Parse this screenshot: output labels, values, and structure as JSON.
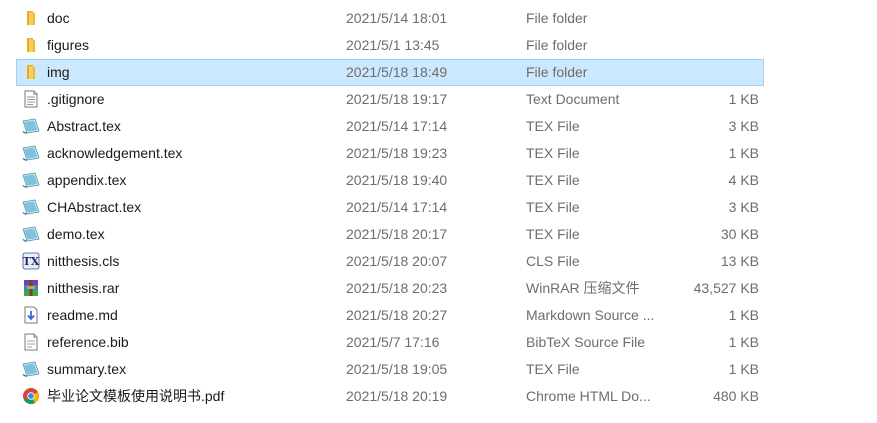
{
  "colors": {
    "selection_bg": "#cce8ff",
    "selection_border": "#99d1ff",
    "folder": "#f4c44e",
    "muted_text": "#6d6d6d"
  },
  "files": [
    {
      "name": "doc",
      "date": "2021/5/14 18:01",
      "type": "File folder",
      "size": "",
      "icon": "folder-icon",
      "selected": false
    },
    {
      "name": "figures",
      "date": "2021/5/1 13:45",
      "type": "File folder",
      "size": "",
      "icon": "folder-icon",
      "selected": false
    },
    {
      "name": "img",
      "date": "2021/5/18 18:49",
      "type": "File folder",
      "size": "",
      "icon": "folder-icon",
      "selected": true
    },
    {
      "name": ".gitignore",
      "date": "2021/5/18 19:17",
      "type": "Text Document",
      "size": "1 KB",
      "icon": "text-document-icon",
      "selected": false
    },
    {
      "name": "Abstract.tex",
      "date": "2021/5/14 17:14",
      "type": "TEX File",
      "size": "3 KB",
      "icon": "tex-file-icon",
      "selected": false
    },
    {
      "name": "acknowledgement.tex",
      "date": "2021/5/18 19:23",
      "type": "TEX File",
      "size": "1 KB",
      "icon": "tex-file-icon",
      "selected": false
    },
    {
      "name": "appendix.tex",
      "date": "2021/5/18 19:40",
      "type": "TEX File",
      "size": "4 KB",
      "icon": "tex-file-icon",
      "selected": false
    },
    {
      "name": "CHAbstract.tex",
      "date": "2021/5/14 17:14",
      "type": "TEX File",
      "size": "3 KB",
      "icon": "tex-file-icon",
      "selected": false
    },
    {
      "name": "demo.tex",
      "date": "2021/5/18 20:17",
      "type": "TEX File",
      "size": "30 KB",
      "icon": "tex-file-icon",
      "selected": false
    },
    {
      "name": "nitthesis.cls",
      "date": "2021/5/18 20:07",
      "type": "CLS File",
      "size": "13 KB",
      "icon": "cls-file-icon",
      "selected": false
    },
    {
      "name": "nitthesis.rar",
      "date": "2021/5/18 20:23",
      "type": "WinRAR 压缩文件",
      "size": "43,527 KB",
      "icon": "winrar-archive-icon",
      "selected": false
    },
    {
      "name": "readme.md",
      "date": "2021/5/18 20:27",
      "type": "Markdown Source ...",
      "size": "1 KB",
      "icon": "markdown-file-icon",
      "selected": false
    },
    {
      "name": "reference.bib",
      "date": "2021/5/7 17:16",
      "type": "BibTeX Source File",
      "size": "1 KB",
      "icon": "bibtex-file-icon",
      "selected": false
    },
    {
      "name": "summary.tex",
      "date": "2021/5/18 19:05",
      "type": "TEX File",
      "size": "1 KB",
      "icon": "tex-file-icon",
      "selected": false
    },
    {
      "name": "毕业论文模板使用说明书.pdf",
      "date": "2021/5/18 20:19",
      "type": "Chrome HTML Do...",
      "size": "480 KB",
      "icon": "chrome-pdf-icon",
      "selected": false
    }
  ]
}
